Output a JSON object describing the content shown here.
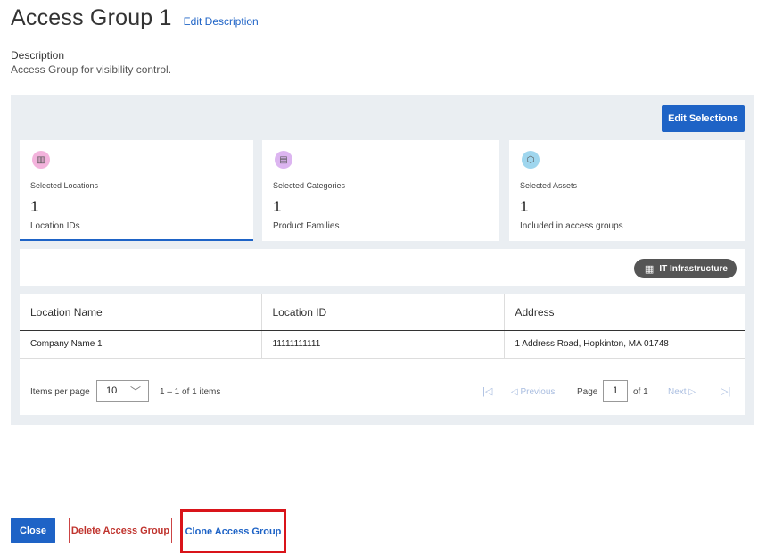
{
  "header": {
    "title": "Access Group 1",
    "edit_description": "Edit Description"
  },
  "description": {
    "label": "Description",
    "text": "Access Group for visibility control."
  },
  "panel": {
    "edit_selections": "Edit Selections",
    "cards": [
      {
        "icon": "building-icon",
        "label": "Selected Locations",
        "count": "1",
        "sub": "Location IDs"
      },
      {
        "icon": "category-icon",
        "label": "Selected Categories",
        "count": "1",
        "sub": "Product Families"
      },
      {
        "icon": "cube-icon",
        "label": "Selected Assets",
        "count": "1",
        "sub": "Included in access groups"
      }
    ],
    "tag": {
      "icon": "server-icon",
      "label": "IT Infrastructure"
    }
  },
  "table": {
    "columns": [
      "Location Name",
      "Location ID",
      "Address"
    ],
    "rows": [
      [
        "Company Name 1",
        "11111111111",
        "1 Address Road, Hopkinton, MA 01748"
      ]
    ]
  },
  "pager": {
    "items_per_page_label": "Items per page",
    "items_per_page_value": "10",
    "range": "1 – 1 of 1 items",
    "previous": "Previous",
    "page_label": "Page",
    "page_value": "1",
    "of_pages": "of 1",
    "next": "Next"
  },
  "footer": {
    "close": "Close",
    "delete": "Delete Access Group",
    "clone": "Clone Access Group"
  },
  "colors": {
    "accent": "#1e63c6",
    "danger": "#c0342e",
    "highlight": "#d9141a",
    "panel_bg": "#eaeef2"
  }
}
